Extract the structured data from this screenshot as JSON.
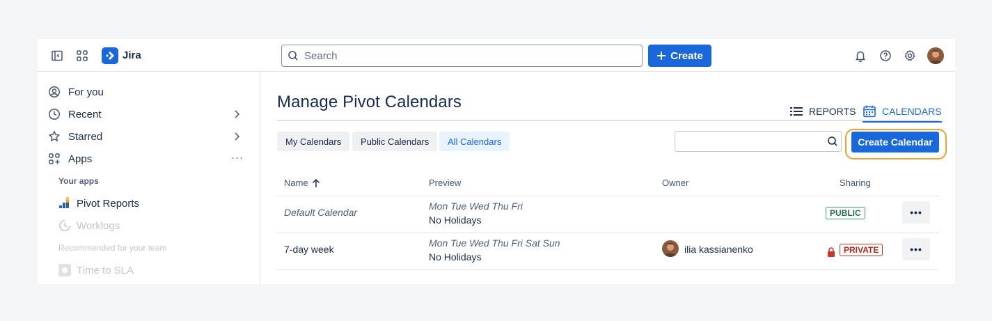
{
  "topbar": {
    "brand": "Jira",
    "search_placeholder": "Search",
    "create_label": "Create"
  },
  "sidebar": {
    "items": [
      {
        "label": "For you"
      },
      {
        "label": "Recent"
      },
      {
        "label": "Starred"
      },
      {
        "label": "Apps"
      }
    ],
    "your_apps_heading": "Your apps",
    "apps": [
      {
        "label": "Pivot Reports"
      },
      {
        "label": "Worklogs"
      }
    ],
    "recommended_heading": "Recommended for your team",
    "recommended": [
      {
        "label": "Time to SLA"
      }
    ]
  },
  "main": {
    "title": "Manage Pivot Calendars",
    "view_tabs": [
      {
        "label": "REPORTS",
        "active": false
      },
      {
        "label": "CALENDARS",
        "active": true
      }
    ],
    "filters": [
      {
        "label": "My Calendars",
        "active": false
      },
      {
        "label": "Public Calendars",
        "active": false
      },
      {
        "label": "All Calendars",
        "active": true
      }
    ],
    "search_value": "",
    "create_calendar_label": "Create Calendar",
    "table": {
      "headers": {
        "name": "Name",
        "preview": "Preview",
        "owner": "Owner",
        "sharing": "Sharing"
      },
      "sort": "Name ascending",
      "rows": [
        {
          "name": "Default Calendar",
          "preview_days": "Mon Tue Wed Thu Fri",
          "preview_holidays": "No Holidays",
          "owner": "",
          "sharing": "PUBLIC",
          "more": "•••"
        },
        {
          "name": "7-day week",
          "preview_days": "Mon Tue Wed Thu Fri Sat Sun",
          "preview_holidays": "No Holidays",
          "owner": "ilia kassianenko",
          "sharing": "PRIVATE",
          "more": "•••"
        }
      ]
    }
  },
  "colors": {
    "accent": "#1868db",
    "highlight": "#f0a030",
    "public": "#216e4e",
    "private": "#ae2a19"
  }
}
